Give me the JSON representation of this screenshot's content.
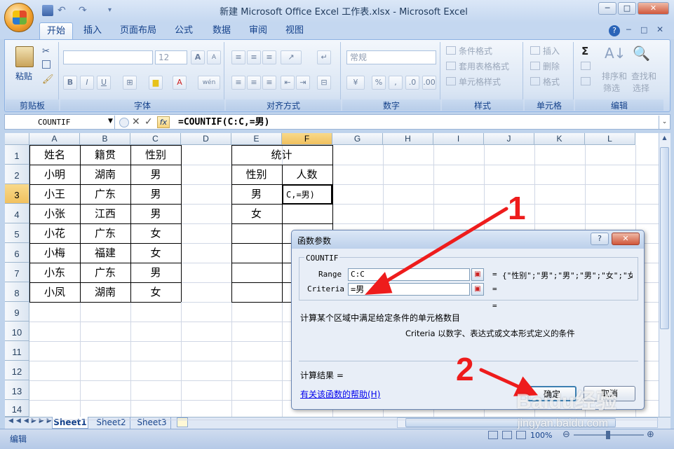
{
  "window": {
    "title": "新建 Microsoft Office Excel 工作表.xlsx - Microsoft Excel",
    "minimize": "─",
    "maximize": "□",
    "close": "✕"
  },
  "tabs": [
    "开始",
    "插入",
    "页面布局",
    "公式",
    "数据",
    "审阅",
    "视图"
  ],
  "ribbon": {
    "clipboard": {
      "paste": "粘贴",
      "title": "剪贴板"
    },
    "font": {
      "title": "字体",
      "size": "12",
      "bold": "B",
      "italic": "I",
      "underline": "U",
      "grow": "A",
      "shrink": "A",
      "color": "A",
      "phonetic": "wén"
    },
    "alignment": {
      "title": "对齐方式"
    },
    "number": {
      "title": "数字",
      "format": "常规",
      "percent": "%",
      "comma": ","
    },
    "styles": {
      "title": "样式",
      "cond": "条件格式",
      "table": "套用表格格式",
      "cell": "单元格样式"
    },
    "cells": {
      "title": "单元格",
      "insert": "插入",
      "delete": "删除",
      "format": "格式"
    },
    "editing": {
      "title": "编辑",
      "sigma": "Σ",
      "sort": "排序和",
      "filter": "筛选",
      "find": "查找和",
      "select": "选择"
    }
  },
  "formula_bar": {
    "name_box": "COUNTIF",
    "fx": "fx",
    "formula": "=COUNTIF(C:C,=男)"
  },
  "columns": [
    "A",
    "B",
    "C",
    "D",
    "E",
    "F",
    "G",
    "H",
    "I",
    "J",
    "K",
    "L"
  ],
  "rows": [
    "1",
    "2",
    "3",
    "4",
    "5",
    "6",
    "7",
    "8",
    "9",
    "10",
    "11",
    "12",
    "13",
    "14"
  ],
  "table1": {
    "headers": [
      "姓名",
      "籍贯",
      "性别"
    ],
    "rows": [
      [
        "小明",
        "湖南",
        "男"
      ],
      [
        "小王",
        "广东",
        "男"
      ],
      [
        "小张",
        "江西",
        "男"
      ],
      [
        "小花",
        "广东",
        "女"
      ],
      [
        "小梅",
        "福建",
        "女"
      ],
      [
        "小东",
        "广东",
        "男"
      ],
      [
        "小凤",
        "湖南",
        "女"
      ]
    ]
  },
  "table2": {
    "title": "统计",
    "h1": "性别",
    "h2": "人数",
    "r1": "男",
    "r2": "女",
    "edit": "C,=男)"
  },
  "dialog": {
    "title": "函数参数",
    "help_q": "?",
    "close": "✕",
    "func": "COUNTIF",
    "range_label": "Range",
    "range_value": "C:C",
    "range_result": "{\"性别\";\"男\";\"男\";\"男\";\"女\";\"女",
    "criteria_label": "Criteria",
    "criteria_value": "=男",
    "eq": "=",
    "description": "计算某个区域中满足给定条件的单元格数目",
    "arg_desc": "Criteria  以数字、表达式或文本形式定义的条件",
    "result": "计算结果 =",
    "help_link": "有关该函数的帮助(H)",
    "ok": "确定",
    "cancel": "取消"
  },
  "annotations": {
    "n1": "1",
    "n2": "2"
  },
  "sheets": [
    "Sheet1",
    "Sheet2",
    "Sheet3"
  ],
  "status": {
    "mode": "编辑",
    "zoom": "100%"
  },
  "watermark": {
    "brand": "Baidu经验",
    "url": "jingyan.baidu.com"
  },
  "colors": {
    "accent": "#15428b",
    "annotation": "#ee1c1c",
    "selected_header": "#f1c15f"
  }
}
